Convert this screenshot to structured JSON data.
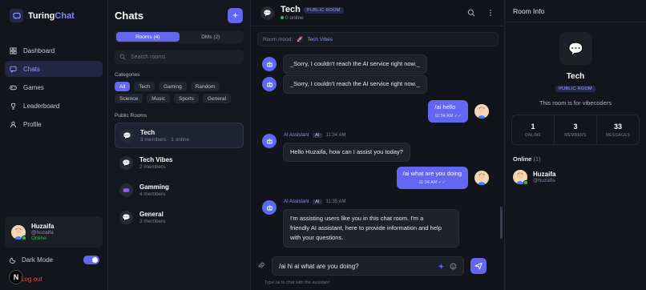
{
  "brand": {
    "prefix": "Turing",
    "suffix": "Chat"
  },
  "nav": {
    "items": [
      {
        "label": "Dashboard",
        "icon": "dashboard-icon"
      },
      {
        "label": "Chats",
        "icon": "chat-bubble-icon",
        "active": true
      },
      {
        "label": "Games",
        "icon": "gamepad-icon"
      },
      {
        "label": "Leaderboard",
        "icon": "trophy-icon"
      },
      {
        "label": "Profile",
        "icon": "user-icon"
      }
    ]
  },
  "user": {
    "name": "Huzaifa",
    "handle": "@huzaifa",
    "status": "Online"
  },
  "settings": {
    "dark_mode_label": "Dark Mode",
    "dark_mode_on": true,
    "logout_label": "Log out"
  },
  "chats_panel": {
    "title": "Chats",
    "tabs": [
      "Rooms (4)",
      "DMs (2)"
    ],
    "search_placeholder": "Search rooms",
    "categories_label": "Categories",
    "categories": [
      "All",
      "Tech",
      "Gaming",
      "Random",
      "Science",
      "Music",
      "Sports",
      "General"
    ],
    "public_rooms_label": "Public Rooms",
    "rooms": [
      {
        "name": "Tech",
        "meta": "3 members · 1 online",
        "active": true
      },
      {
        "name": "Tech Vibes",
        "meta": "2 members"
      },
      {
        "name": "Gamming",
        "meta": "4 members"
      },
      {
        "name": "General",
        "meta": "3 members"
      }
    ]
  },
  "room": {
    "name": "Tech",
    "badge": "PUBLIC ROOM",
    "online": "0 online",
    "mood_label": "Room mood:",
    "mood_value": "Tech Vibes"
  },
  "messages": {
    "m1": "_Sorry, I couldn't reach the AI service right now._",
    "m2": "_Sorry, I couldn't reach the AI service right now._",
    "m3": "/ai hello",
    "m3_time": "11:34 AM",
    "m4_sender": "AI Assistant",
    "m4_tag": "AI",
    "m4_time": "11:34 AM",
    "m4": "Hello Huzaifa, how can I assist you today?",
    "m5": "/ai what are you doing",
    "m5_time": "11:34 AM",
    "m6_sender": "AI Assistant",
    "m6_tag": "AI",
    "m6_time": "11:35 AM",
    "m6_l1": "I'm assisting users like you in this chat room. I'm a",
    "m6_l2": "friendly AI assistant, here to provide information and help",
    "m6_l3": "with your questions.",
    "read_mark": "✓✓"
  },
  "composer": {
    "value": "/ai hi ai what are you doing?",
    "hint": "Type /ai to chat with the assistant"
  },
  "info": {
    "header": "Room Info",
    "title": "Tech",
    "badge": "PUBLIC ROOM",
    "description": "This room is for vibecoders",
    "stats": [
      {
        "value": "1",
        "label": "ONLINE"
      },
      {
        "value": "3",
        "label": "MEMBERS"
      },
      {
        "value": "33",
        "label": "MESSAGES"
      }
    ],
    "online_label": "Online",
    "online_count": "(1)",
    "online_user": {
      "name": "Huzaifa",
      "handle": "@huzaifa"
    }
  },
  "colors": {
    "accent": "#6366f1",
    "online": "#22c55e",
    "danger": "#ef4444",
    "bg": "#0f1117"
  }
}
